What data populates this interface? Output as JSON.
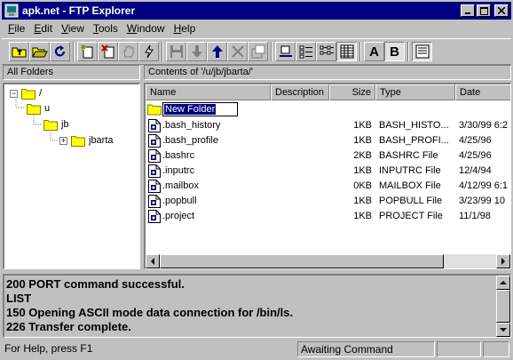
{
  "window": {
    "title": "apk.net - FTP Explorer"
  },
  "menu": [
    {
      "label": "File",
      "accel": "F",
      "rest": "ile"
    },
    {
      "label": "Edit",
      "accel": "E",
      "rest": "dit"
    },
    {
      "label": "View",
      "accel": "V",
      "rest": "iew"
    },
    {
      "label": "Tools",
      "accel": "T",
      "rest": "ools"
    },
    {
      "label": "Window",
      "accel": "W",
      "rest": "indow"
    },
    {
      "label": "Help",
      "accel": "H",
      "rest": "elp"
    }
  ],
  "toolbar": {
    "view_large_label": "A",
    "view_bold_label": "B"
  },
  "tree": {
    "header": "All Folders",
    "nodes": [
      {
        "label": "/",
        "expander": "−"
      },
      {
        "label": "u",
        "expander": ""
      },
      {
        "label": "jb",
        "expander": ""
      },
      {
        "label": "jbarta",
        "expander": "+"
      }
    ]
  },
  "list": {
    "header": "Contents of '/u/jb/jbarta/'",
    "columns": [
      "Name",
      "Description",
      "Size",
      "Type",
      "Date"
    ],
    "new_folder": "New Folder",
    "rows": [
      {
        "name": ".bash_history",
        "description": "",
        "size": "1KB",
        "type": "BASH_HISTO...",
        "date": "3/30/99 6:2"
      },
      {
        "name": ".bash_profile",
        "description": "",
        "size": "1KB",
        "type": "BASH_PROFI...",
        "date": "4/25/96"
      },
      {
        "name": ".bashrc",
        "description": "",
        "size": "2KB",
        "type": "BASHRC File",
        "date": "4/25/96"
      },
      {
        "name": ".inputrc",
        "description": "",
        "size": "1KB",
        "type": "INPUTRC File",
        "date": "12/4/94"
      },
      {
        "name": ".mailbox",
        "description": "",
        "size": "0KB",
        "type": "MAILBOX File",
        "date": "4/12/99 6:1"
      },
      {
        "name": ".popbull",
        "description": "",
        "size": "1KB",
        "type": "POPBULL File",
        "date": "3/23/99 10"
      },
      {
        "name": ".project",
        "description": "",
        "size": "1KB",
        "type": "PROJECT File",
        "date": "11/1/98"
      }
    ]
  },
  "log": {
    "lines": [
      "200 PORT command successful.",
      "LIST",
      "150 Opening ASCII mode data connection for /bin/ls.",
      "226 Transfer complete."
    ]
  },
  "status": {
    "help": "For Help, press F1",
    "command": "Awaiting Command",
    "extra1": "",
    "extra2": ""
  },
  "colors": {
    "titlebar": "#000080",
    "face": "#c0c0c0",
    "folder": "#ffff00",
    "selection": "#000080"
  },
  "icons": [
    "app-icon",
    "minimize-icon",
    "maximize-icon",
    "close-icon",
    "up-folder-icon",
    "open-folder-icon",
    "refresh-icon",
    "new-folder-icon",
    "delete-icon",
    "hand-icon",
    "connect-icon",
    "save-icon",
    "download-icon",
    "upload-icon",
    "cancel-icon",
    "properties-icon",
    "large-icons-icon",
    "small-icons-icon",
    "list-view-icon",
    "details-view-icon",
    "font-a-icon",
    "font-b-icon",
    "log-view-icon",
    "folder-icon",
    "file-icon"
  ]
}
